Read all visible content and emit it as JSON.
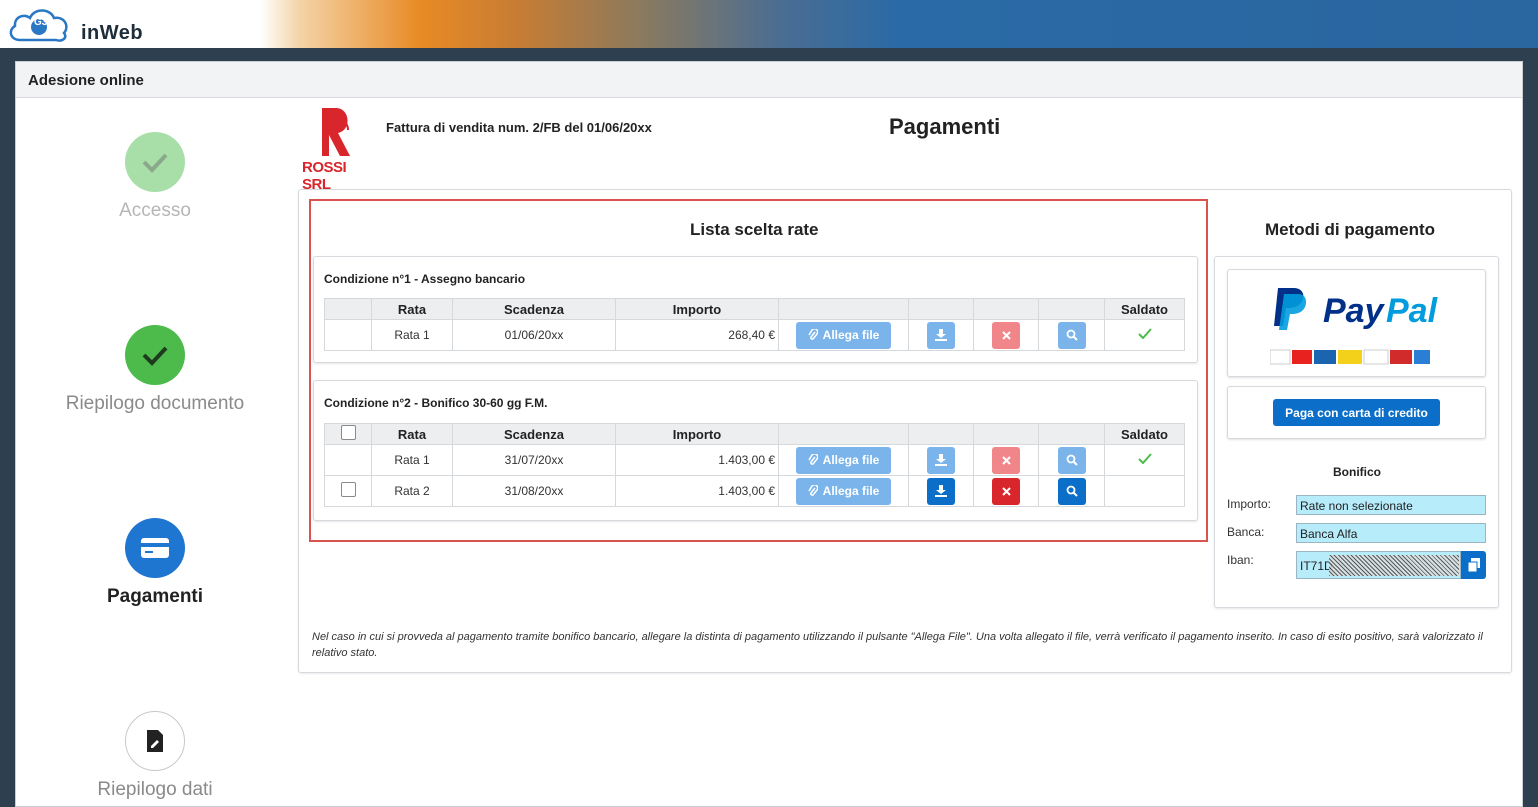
{
  "app": {
    "logo_text": "inWeb",
    "logo_badge": "G3"
  },
  "window": {
    "title": "Adesione online"
  },
  "steps": [
    {
      "label": "Accesso",
      "state": "done-light",
      "icon": "check-icon"
    },
    {
      "label": "Riepilogo documento",
      "state": "done",
      "icon": "check-icon"
    },
    {
      "label": "Pagamenti",
      "state": "active",
      "icon": "credit-card-icon"
    },
    {
      "label": "Riepilogo dati",
      "state": "todo",
      "icon": "document-edit-icon"
    }
  ],
  "header": {
    "brand": "ROSSI SRL",
    "invoice": "Fattura di vendita num. 2/FB del 01/06/20xx",
    "page_title": "Pagamenti"
  },
  "rate_list": {
    "title": "Lista scelta rate",
    "columns": [
      "",
      "Rata",
      "Scadenza",
      "Importo",
      "",
      "",
      "",
      "",
      "Saldato"
    ],
    "conditions": [
      {
        "title": "Condizione n°1 - Assegno bancario",
        "rows": [
          {
            "rata": "Rata 1",
            "scadenza": "01/06/20xx",
            "importo": "268,40 €",
            "allega": "Allega file",
            "saldato": true,
            "checkbox": false,
            "enabled": false
          }
        ]
      },
      {
        "title": "Condizione n°2 - Bonifico 30-60 gg F.M.",
        "rows": [
          {
            "rata": "Rata 1",
            "scadenza": "31/07/20xx",
            "importo": "1.403,00 €",
            "allega": "Allega file",
            "saldato": true,
            "checkbox": false,
            "enabled": false
          },
          {
            "rata": "Rata 2",
            "scadenza": "31/08/20xx",
            "importo": "1.403,00 €",
            "allega": "Allega file",
            "saldato": false,
            "checkbox": true,
            "enabled": true
          }
        ]
      }
    ]
  },
  "payment_methods": {
    "title": "Metodi di pagamento",
    "paypal": {
      "logo_text_a": "Pay",
      "logo_text_b": "Pal",
      "cards": [
        "VISA",
        "MC",
        "Maestro",
        "Postepay",
        "DISCOVER",
        "Aura",
        "AMEX"
      ]
    },
    "credit_card_button": "Paga con carta di credito",
    "bonifico": {
      "title": "Bonifico",
      "importo_label": "Importo:",
      "importo_value": "Rate non selezionate",
      "banca_label": "Banca:",
      "banca_value": "Banca Alfa",
      "iban_label": "Iban:",
      "iban_value": "IT71D"
    }
  },
  "note": "Nel caso in cui si provveda al pagamento tramite bonifico bancario, allegare la distinta di pagamento utilizzando il pulsante \"Allega File\". Una volta allegato il file, verrà verificato il pagamento inserito. In caso di esito positivo, sarà valorizzato il relativo stato.",
  "colors": {
    "primary": "#0b6fc9",
    "success": "#4cbb4c",
    "danger": "#d9262c",
    "frame": "#d9534f",
    "brand_red": "#d9262c",
    "paypal_dark": "#003087",
    "paypal_light": "#009cde"
  }
}
